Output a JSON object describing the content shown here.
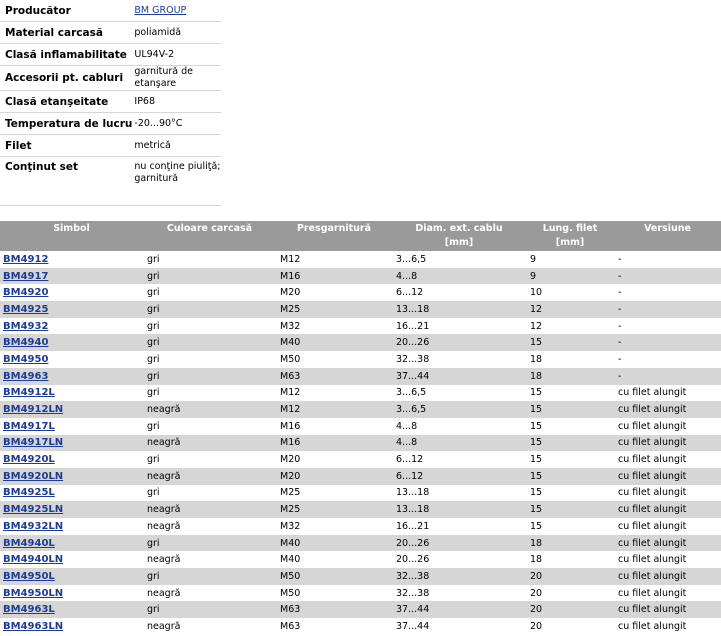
{
  "spec": [
    {
      "key": "Producător",
      "value": "BM GROUP",
      "link": true
    },
    {
      "key": "Material carcasă",
      "value": "poliamidă"
    },
    {
      "key": "Clasă inflamabilitate",
      "value": "UL94V-2"
    },
    {
      "key": "Accesorii pt. cabluri",
      "value": "garnitură de etanşare"
    },
    {
      "key": "Clasă etanşeitate",
      "value": "IP68"
    },
    {
      "key": "Temperatura de lucru",
      "value": "-20...90°C"
    },
    {
      "key": "Filet",
      "value": "metrică"
    },
    {
      "key": "Conţinut set",
      "value": "nu conţine piuliţă; garnitură"
    }
  ],
  "table": {
    "headers": {
      "symbol": "Simbol",
      "color": "Culoare carcasă",
      "gland": "Presgarnitură",
      "diam": "Diam. ext. cablu",
      "diam_unit": "[mm]",
      "length": "Lung. filet",
      "length_unit": "[mm]",
      "version": "Versiune"
    },
    "rows": [
      [
        "BM4912",
        "gri",
        "M12",
        "3...6,5",
        "9",
        "-"
      ],
      [
        "BM4917",
        "gri",
        "M16",
        "4...8",
        "9",
        "-"
      ],
      [
        "BM4920",
        "gri",
        "M20",
        "6...12",
        "10",
        "-"
      ],
      [
        "BM4925",
        "gri",
        "M25",
        "13...18",
        "12",
        "-"
      ],
      [
        "BM4932",
        "gri",
        "M32",
        "16...21",
        "12",
        "-"
      ],
      [
        "BM4940",
        "gri",
        "M40",
        "20...26",
        "15",
        "-"
      ],
      [
        "BM4950",
        "gri",
        "M50",
        "32...38",
        "18",
        "-"
      ],
      [
        "BM4963",
        "gri",
        "M63",
        "37...44",
        "18",
        "-"
      ],
      [
        "BM4912L",
        "gri",
        "M12",
        "3...6,5",
        "15",
        "cu filet alungit"
      ],
      [
        "BM4912LN",
        "neagră",
        "M12",
        "3...6,5",
        "15",
        "cu filet alungit"
      ],
      [
        "BM4917L",
        "gri",
        "M16",
        "4...8",
        "15",
        "cu filet alungit"
      ],
      [
        "BM4917LN",
        "neagră",
        "M16",
        "4...8",
        "15",
        "cu filet alungit"
      ],
      [
        "BM4920L",
        "gri",
        "M20",
        "6...12",
        "15",
        "cu filet alungit"
      ],
      [
        "BM4920LN",
        "neagră",
        "M20",
        "6...12",
        "15",
        "cu filet alungit"
      ],
      [
        "BM4925L",
        "gri",
        "M25",
        "13...18",
        "15",
        "cu filet alungit"
      ],
      [
        "BM4925LN",
        "neagră",
        "M25",
        "13...18",
        "15",
        "cu filet alungit"
      ],
      [
        "BM4932LN",
        "neagră",
        "M32",
        "16...21",
        "15",
        "cu filet alungit"
      ],
      [
        "BM4940L",
        "gri",
        "M40",
        "20...26",
        "18",
        "cu filet alungit"
      ],
      [
        "BM4940LN",
        "neagră",
        "M40",
        "20...26",
        "18",
        "cu filet alungit"
      ],
      [
        "BM4950L",
        "gri",
        "M50",
        "32...38",
        "20",
        "cu filet alungit"
      ],
      [
        "BM4950LN",
        "neagră",
        "M50",
        "32...38",
        "20",
        "cu filet alungit"
      ],
      [
        "BM4963L",
        "gri",
        "M63",
        "37...44",
        "20",
        "cu filet alungit"
      ],
      [
        "BM4963LN",
        "neagră",
        "M63",
        "37...44",
        "20",
        "cu filet alungit"
      ]
    ]
  },
  "colors": {
    "header_bg": "#9a9a9a",
    "row_alt": "#d6d6d6",
    "link": "#1e3c96"
  }
}
